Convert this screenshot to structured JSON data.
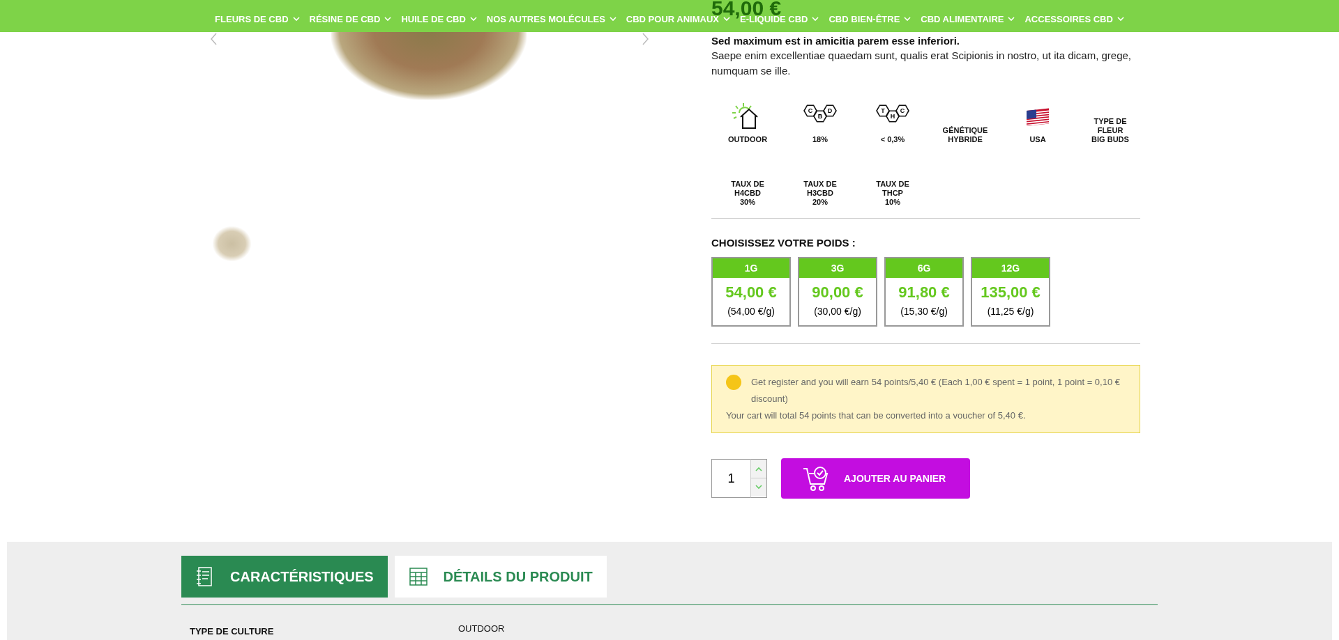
{
  "nav": [
    {
      "label": "FLEURS DE CBD"
    },
    {
      "label": "RÉSINE DE CBD"
    },
    {
      "label": "HUILE DE CBD"
    },
    {
      "label": "NOS AUTRES MOLÉCULES"
    },
    {
      "label": "CBD POUR ANIMAUX"
    },
    {
      "label": "E-LIQUIDE CBD"
    },
    {
      "label": "CBD BIEN-ÊTRE"
    },
    {
      "label": "CBD ALIMENTAIRE"
    },
    {
      "label": "ACCESSOIRES CBD"
    }
  ],
  "product": {
    "price": "54,00 €",
    "subtitle": "Sed maximum est in amicitia parem esse inferiori.",
    "description": "Saepe enim excellentiae quaedam sunt, qualis erat Scipionis in nostro, ut ita dicam, grege, numquam se ille."
  },
  "features": [
    {
      "kind": "outdoor",
      "lines": [
        "OUTDOOR"
      ]
    },
    {
      "kind": "molecule",
      "icon_letters": [
        "C",
        "B",
        "D"
      ],
      "lines": [
        "18%"
      ]
    },
    {
      "kind": "molecule",
      "icon_letters": [
        "T",
        "H",
        "C"
      ],
      "lines": [
        "< 0,3%"
      ]
    },
    {
      "kind": "text",
      "lines": [
        "GÉNÉTIQUE",
        "HYBRIDE"
      ]
    },
    {
      "kind": "flag",
      "lines": [
        "USA"
      ]
    },
    {
      "kind": "text",
      "lines": [
        "TYPE DE",
        "FLEUR",
        "BIG BUDS"
      ]
    },
    {
      "kind": "text",
      "lines": [
        "TAUX DE",
        "H4CBD",
        "30%"
      ]
    },
    {
      "kind": "text",
      "lines": [
        "TAUX DE",
        "H3CBD",
        "20%"
      ]
    },
    {
      "kind": "text",
      "lines": [
        "TAUX DE",
        "THCP",
        "10%"
      ]
    }
  ],
  "weight_title": "CHOISISSEZ VOTRE POIDS :",
  "weights": [
    {
      "weight": "1G",
      "price": "54,00 €",
      "unit_price": "(54,00 €/g)"
    },
    {
      "weight": "3G",
      "price": "90,00 €",
      "unit_price": "(30,00 €/g)"
    },
    {
      "weight": "6G",
      "price": "91,80 €",
      "unit_price": "(15,30 €/g)"
    },
    {
      "weight": "12G",
      "price": "135,00 €",
      "unit_price": "(11,25 €/g)"
    }
  ],
  "loyalty": {
    "earn_text": "Get register and you will earn 54 points/5,40 € (Each 1,00 € spent = 1 point, 1 point = 0,10 € discount)",
    "total_text": "Your cart will total 54 points that can be converted into a voucher of 5,40 €."
  },
  "cart": {
    "quantity": "1",
    "button": "AJOUTER AU PANIER"
  },
  "tabs": [
    {
      "label": "CARACTÉRISTIQUES",
      "selected": true,
      "kind": "notebook"
    },
    {
      "label": "DÉTAILS DU PRODUIT",
      "selected": false,
      "kind": "table"
    }
  ],
  "specs": [
    {
      "label": "TYPE DE CULTURE",
      "value": "OUTDOOR"
    }
  ]
}
